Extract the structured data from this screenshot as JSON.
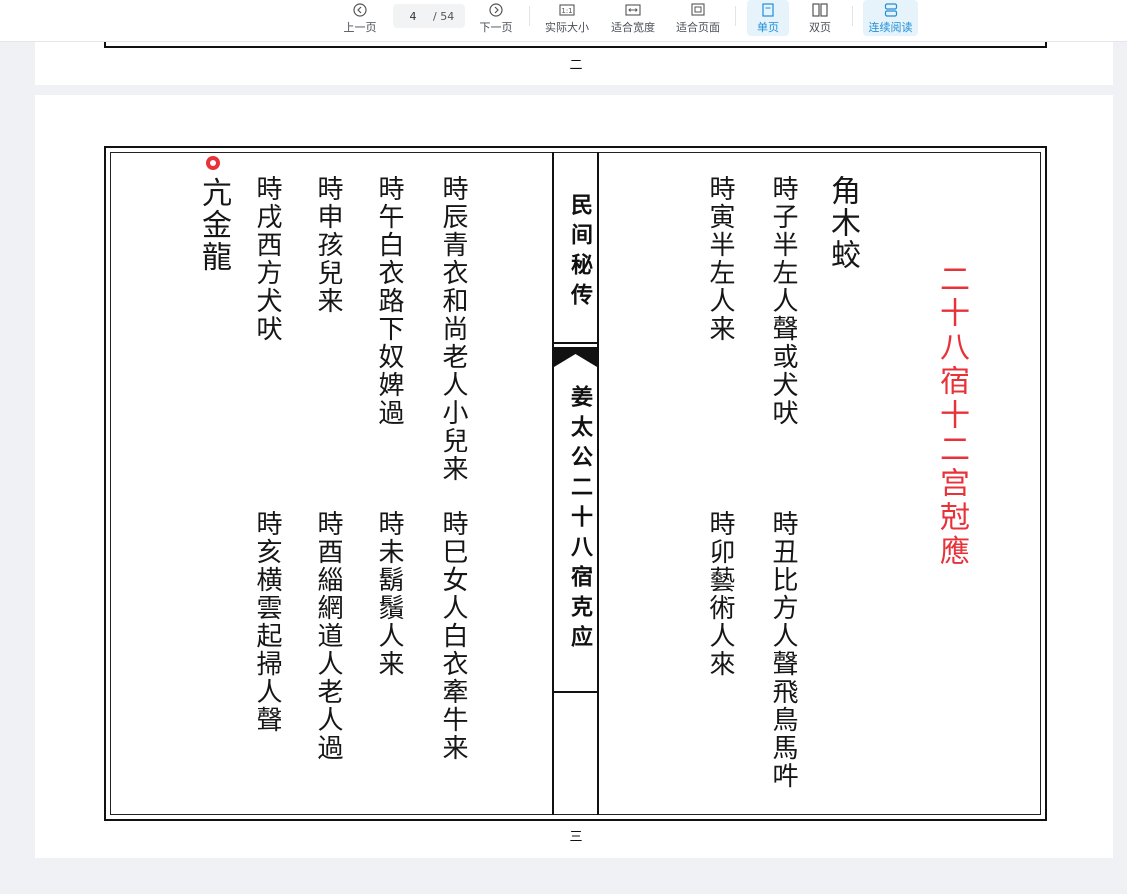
{
  "toolbar": {
    "prev_label": "上一页",
    "page_current": "4",
    "page_total": "/ 54",
    "next_label": "下一页",
    "actual_size_label": "实际大小",
    "fit_width_label": "适合宽度",
    "fit_page_label": "适合页面",
    "single_page_label": "单页",
    "double_page_label": "双页",
    "continuous_label": "连续阅读",
    "active_color": "#1f8fd6"
  },
  "top_page": {
    "page_number": "二"
  },
  "main_page": {
    "page_number": "三",
    "spine_top": "民间秘传",
    "spine_bottom": "姜太公二十八宿克应",
    "red_title": "二十八宿十二宫尅應",
    "right_columns": [
      "角木蛟",
      "時子半左人聲或犬吠",
      "時寅半左人来",
      "時丑比方人聲飛鳥馬吽",
      "時卯藝術人來"
    ],
    "left_columns": [
      "時辰青衣和尚老人小兒来",
      "時午白衣路下奴婢過",
      "時申孩兒来",
      "時戌西方犬吠",
      "亢金龍",
      "時巳女人白衣牽牛来",
      "時未鬍鬚人来",
      "時酉緇網道人老人過",
      "時亥横雲起掃人聲"
    ]
  }
}
